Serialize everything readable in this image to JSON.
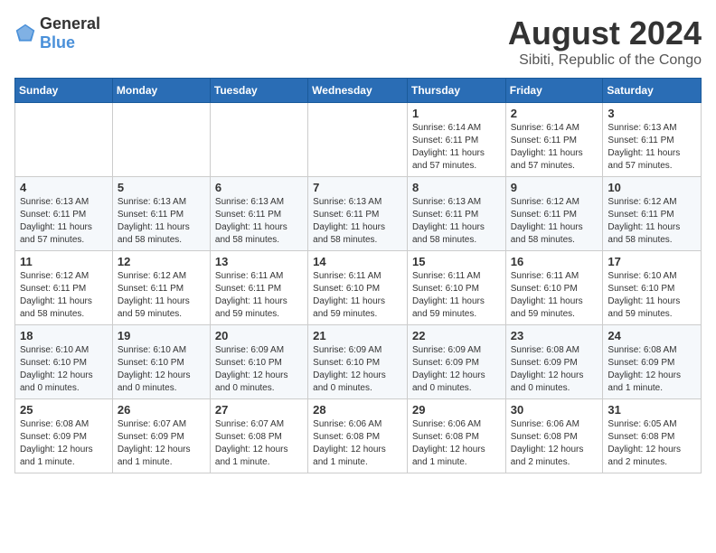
{
  "logo": {
    "text_general": "General",
    "text_blue": "Blue"
  },
  "header": {
    "month_year": "August 2024",
    "location": "Sibiti, Republic of the Congo"
  },
  "weekdays": [
    "Sunday",
    "Monday",
    "Tuesday",
    "Wednesday",
    "Thursday",
    "Friday",
    "Saturday"
  ],
  "weeks": [
    [
      {
        "day": "",
        "info": ""
      },
      {
        "day": "",
        "info": ""
      },
      {
        "day": "",
        "info": ""
      },
      {
        "day": "",
        "info": ""
      },
      {
        "day": "1",
        "info": "Sunrise: 6:14 AM\nSunset: 6:11 PM\nDaylight: 11 hours\nand 57 minutes."
      },
      {
        "day": "2",
        "info": "Sunrise: 6:14 AM\nSunset: 6:11 PM\nDaylight: 11 hours\nand 57 minutes."
      },
      {
        "day": "3",
        "info": "Sunrise: 6:13 AM\nSunset: 6:11 PM\nDaylight: 11 hours\nand 57 minutes."
      }
    ],
    [
      {
        "day": "4",
        "info": "Sunrise: 6:13 AM\nSunset: 6:11 PM\nDaylight: 11 hours\nand 57 minutes."
      },
      {
        "day": "5",
        "info": "Sunrise: 6:13 AM\nSunset: 6:11 PM\nDaylight: 11 hours\nand 58 minutes."
      },
      {
        "day": "6",
        "info": "Sunrise: 6:13 AM\nSunset: 6:11 PM\nDaylight: 11 hours\nand 58 minutes."
      },
      {
        "day": "7",
        "info": "Sunrise: 6:13 AM\nSunset: 6:11 PM\nDaylight: 11 hours\nand 58 minutes."
      },
      {
        "day": "8",
        "info": "Sunrise: 6:13 AM\nSunset: 6:11 PM\nDaylight: 11 hours\nand 58 minutes."
      },
      {
        "day": "9",
        "info": "Sunrise: 6:12 AM\nSunset: 6:11 PM\nDaylight: 11 hours\nand 58 minutes."
      },
      {
        "day": "10",
        "info": "Sunrise: 6:12 AM\nSunset: 6:11 PM\nDaylight: 11 hours\nand 58 minutes."
      }
    ],
    [
      {
        "day": "11",
        "info": "Sunrise: 6:12 AM\nSunset: 6:11 PM\nDaylight: 11 hours\nand 58 minutes."
      },
      {
        "day": "12",
        "info": "Sunrise: 6:12 AM\nSunset: 6:11 PM\nDaylight: 11 hours\nand 59 minutes."
      },
      {
        "day": "13",
        "info": "Sunrise: 6:11 AM\nSunset: 6:11 PM\nDaylight: 11 hours\nand 59 minutes."
      },
      {
        "day": "14",
        "info": "Sunrise: 6:11 AM\nSunset: 6:10 PM\nDaylight: 11 hours\nand 59 minutes."
      },
      {
        "day": "15",
        "info": "Sunrise: 6:11 AM\nSunset: 6:10 PM\nDaylight: 11 hours\nand 59 minutes."
      },
      {
        "day": "16",
        "info": "Sunrise: 6:11 AM\nSunset: 6:10 PM\nDaylight: 11 hours\nand 59 minutes."
      },
      {
        "day": "17",
        "info": "Sunrise: 6:10 AM\nSunset: 6:10 PM\nDaylight: 11 hours\nand 59 minutes."
      }
    ],
    [
      {
        "day": "18",
        "info": "Sunrise: 6:10 AM\nSunset: 6:10 PM\nDaylight: 12 hours\nand 0 minutes."
      },
      {
        "day": "19",
        "info": "Sunrise: 6:10 AM\nSunset: 6:10 PM\nDaylight: 12 hours\nand 0 minutes."
      },
      {
        "day": "20",
        "info": "Sunrise: 6:09 AM\nSunset: 6:10 PM\nDaylight: 12 hours\nand 0 minutes."
      },
      {
        "day": "21",
        "info": "Sunrise: 6:09 AM\nSunset: 6:10 PM\nDaylight: 12 hours\nand 0 minutes."
      },
      {
        "day": "22",
        "info": "Sunrise: 6:09 AM\nSunset: 6:09 PM\nDaylight: 12 hours\nand 0 minutes."
      },
      {
        "day": "23",
        "info": "Sunrise: 6:08 AM\nSunset: 6:09 PM\nDaylight: 12 hours\nand 0 minutes."
      },
      {
        "day": "24",
        "info": "Sunrise: 6:08 AM\nSunset: 6:09 PM\nDaylight: 12 hours\nand 1 minute."
      }
    ],
    [
      {
        "day": "25",
        "info": "Sunrise: 6:08 AM\nSunset: 6:09 PM\nDaylight: 12 hours\nand 1 minute."
      },
      {
        "day": "26",
        "info": "Sunrise: 6:07 AM\nSunset: 6:09 PM\nDaylight: 12 hours\nand 1 minute."
      },
      {
        "day": "27",
        "info": "Sunrise: 6:07 AM\nSunset: 6:08 PM\nDaylight: 12 hours\nand 1 minute."
      },
      {
        "day": "28",
        "info": "Sunrise: 6:06 AM\nSunset: 6:08 PM\nDaylight: 12 hours\nand 1 minute."
      },
      {
        "day": "29",
        "info": "Sunrise: 6:06 AM\nSunset: 6:08 PM\nDaylight: 12 hours\nand 1 minute."
      },
      {
        "day": "30",
        "info": "Sunrise: 6:06 AM\nSunset: 6:08 PM\nDaylight: 12 hours\nand 2 minutes."
      },
      {
        "day": "31",
        "info": "Sunrise: 6:05 AM\nSunset: 6:08 PM\nDaylight: 12 hours\nand 2 minutes."
      }
    ]
  ]
}
